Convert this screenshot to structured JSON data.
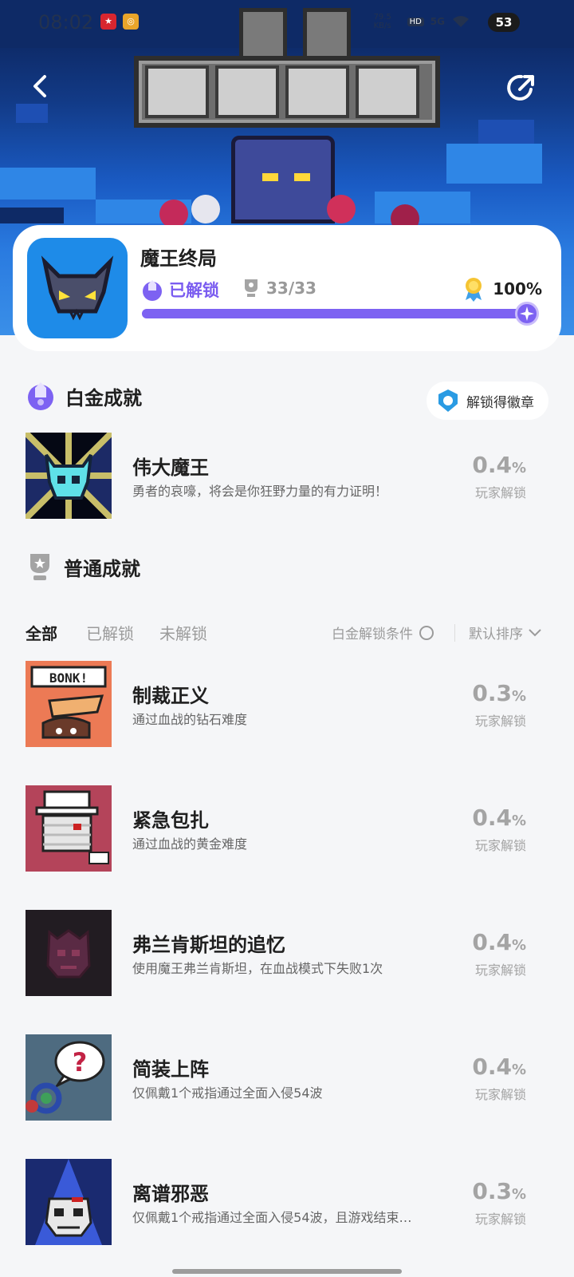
{
  "status_bar": {
    "time": "08:02",
    "net_speed": "79.5 KB/s",
    "network": "5G",
    "hd_badge": "HD",
    "battery": "53"
  },
  "hero": {
    "title_art": "魔王终局"
  },
  "game": {
    "name": "魔王终局",
    "status": "已解锁",
    "trophy_count": "33/33",
    "completion": "100%",
    "progress_fraction": 1.0
  },
  "platinum": {
    "section_title": "白金成就",
    "badge_button": "解锁得徽章",
    "item": {
      "name": "伟大魔王",
      "desc": "勇者的哀嚎，将会是你狂野力量的有力证明！",
      "rate": "0.4",
      "rate_unit": "%",
      "rate_label": "玩家解锁"
    }
  },
  "normal": {
    "section_title": "普通成就",
    "tabs": [
      "全部",
      "已解锁",
      "未解锁"
    ],
    "active_tab": "全部",
    "condition_label": "白金解锁条件",
    "sort_label": "默认排序",
    "items": [
      {
        "name": "制裁正义",
        "desc": "通过血战的钻石难度",
        "rate": "0.3",
        "rate_unit": "%",
        "rate_label": "玩家解锁"
      },
      {
        "name": "紧急包扎",
        "desc": "通过血战的黄金难度",
        "rate": "0.4",
        "rate_unit": "%",
        "rate_label": "玩家解锁"
      },
      {
        "name": "弗兰肯斯坦的追忆",
        "desc": "使用魔王弗兰肯斯坦，在血战模式下失败1次",
        "rate": "0.4",
        "rate_unit": "%",
        "rate_label": "玩家解锁"
      },
      {
        "name": "简装上阵",
        "desc": "仅佩戴1个戒指通过全面入侵54波",
        "rate": "0.4",
        "rate_unit": "%",
        "rate_label": "玩家解锁"
      },
      {
        "name": "离谱邪恶",
        "desc": "仅佩戴1个戒指通过全面入侵54波，且游戏结束…",
        "rate": "0.3",
        "rate_unit": "%",
        "rate_label": "玩家解锁"
      }
    ]
  },
  "thumb_art": {
    "bonk_text": "BONK!",
    "question_text": "?"
  },
  "colors": {
    "accent": "#7d62f2",
    "accent_text": "#7a5cf0",
    "background": "#f5f6f8",
    "rate_gray": "#a4a4a4"
  }
}
